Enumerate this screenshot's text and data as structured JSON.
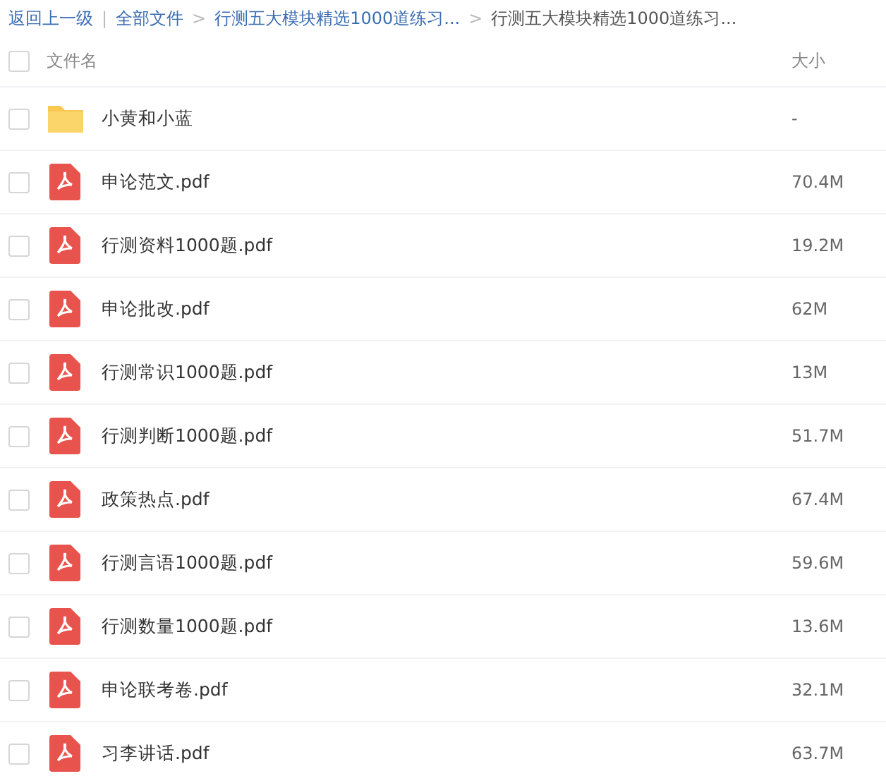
{
  "breadcrumb": [
    {
      "kind": "link",
      "text": "返回上一级"
    },
    {
      "kind": "divider",
      "text": "|"
    },
    {
      "kind": "link",
      "text": "全部文件"
    },
    {
      "kind": "arrow",
      "text": ">"
    },
    {
      "kind": "link",
      "text": "行测五大模块精选1000道练习..."
    },
    {
      "kind": "arrow",
      "text": ">"
    },
    {
      "kind": "current",
      "text": "行测五大模块精选1000道练习..."
    }
  ],
  "table": {
    "select_all": {
      "checked": false
    },
    "columns": [
      "文件名",
      "大小"
    ],
    "rows": [
      {
        "kind": "folder",
        "name": "小黄和小蓝",
        "size": "-",
        "checked": false
      },
      {
        "kind": "pdf",
        "name": "申论范文.pdf",
        "size": "70.4M",
        "checked": false
      },
      {
        "kind": "pdf",
        "name": "行测资料1000题.pdf",
        "size": "19.2M",
        "checked": false
      },
      {
        "kind": "pdf",
        "name": "申论批改.pdf",
        "size": "62M",
        "checked": false
      },
      {
        "kind": "pdf",
        "name": "行测常识1000题.pdf",
        "size": "13M",
        "checked": false
      },
      {
        "kind": "pdf",
        "name": "行测判断1000题.pdf",
        "size": "51.7M",
        "checked": false
      },
      {
        "kind": "pdf",
        "name": "政策热点.pdf",
        "size": "67.4M",
        "checked": false
      },
      {
        "kind": "pdf",
        "name": "行测言语1000题.pdf",
        "size": "59.6M",
        "checked": false
      },
      {
        "kind": "pdf",
        "name": "行测数量1000题.pdf",
        "size": "13.6M",
        "checked": false
      },
      {
        "kind": "pdf",
        "name": "申论联考卷.pdf",
        "size": "32.1M",
        "checked": false
      },
      {
        "kind": "pdf",
        "name": "习李讲话.pdf",
        "size": "63.7M",
        "checked": false
      }
    ]
  }
}
